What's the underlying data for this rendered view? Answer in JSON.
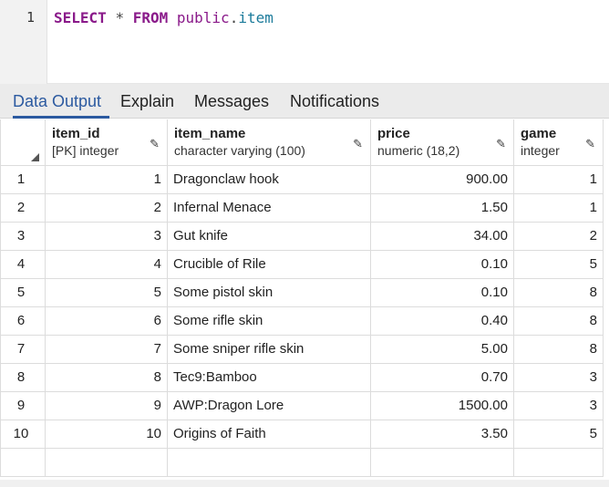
{
  "editor": {
    "line_number": "1",
    "tokens": {
      "select": "SELECT",
      "star": "*",
      "from": "FROM",
      "schema": "public",
      "dot": ".",
      "table": "item"
    }
  },
  "tabs": [
    {
      "label": "Data Output",
      "active": true
    },
    {
      "label": "Explain",
      "active": false
    },
    {
      "label": "Messages",
      "active": false
    },
    {
      "label": "Notifications",
      "active": false
    }
  ],
  "grid": {
    "columns": [
      {
        "name": "item_id",
        "type": "[PK] integer"
      },
      {
        "name": "item_name",
        "type": "character varying (100)"
      },
      {
        "name": "price",
        "type": "numeric (18,2)"
      },
      {
        "name": "game",
        "type": "integer"
      }
    ],
    "rows": [
      {
        "rn": "1",
        "item_id": "1",
        "item_name": "Dragonclaw hook",
        "price": "900.00",
        "game": "1"
      },
      {
        "rn": "2",
        "item_id": "2",
        "item_name": "Infernal Menace",
        "price": "1.50",
        "game": "1"
      },
      {
        "rn": "3",
        "item_id": "3",
        "item_name": "Gut knife",
        "price": "34.00",
        "game": "2"
      },
      {
        "rn": "4",
        "item_id": "4",
        "item_name": "Crucible of Rile",
        "price": "0.10",
        "game": "5"
      },
      {
        "rn": "5",
        "item_id": "5",
        "item_name": "Some pistol skin",
        "price": "0.10",
        "game": "8"
      },
      {
        "rn": "6",
        "item_id": "6",
        "item_name": "Some rifle skin",
        "price": "0.40",
        "game": "8"
      },
      {
        "rn": "7",
        "item_id": "7",
        "item_name": "Some sniper rifle skin",
        "price": "5.00",
        "game": "8"
      },
      {
        "rn": "8",
        "item_id": "8",
        "item_name": "Tec9:Bamboo",
        "price": "0.70",
        "game": "3"
      },
      {
        "rn": "9",
        "item_id": "9",
        "item_name": "AWP:Dragon Lore",
        "price": "1500.00",
        "game": "3"
      },
      {
        "rn": "10",
        "item_id": "10",
        "item_name": "Origins of Faith",
        "price": "3.50",
        "game": "5"
      }
    ]
  },
  "colors": {
    "accent": "#2c5aa0",
    "keyword": "#8a1a8a",
    "property": "#1a7a9a"
  }
}
